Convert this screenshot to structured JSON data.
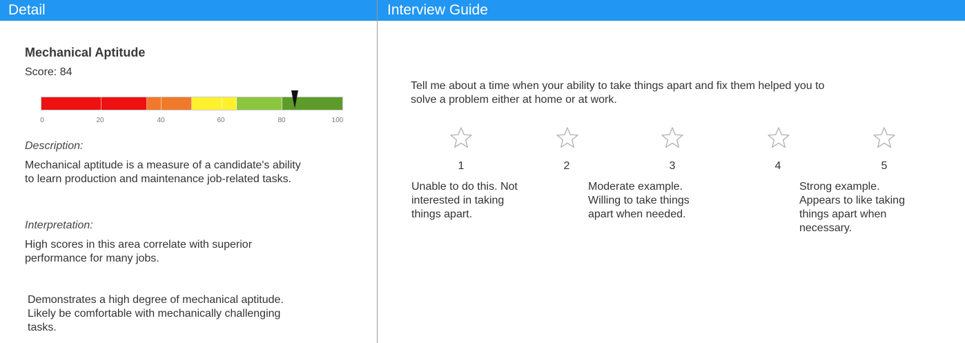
{
  "detail": {
    "header": "Detail",
    "title": "Mechanical Aptitude",
    "score_text": "Score: 84",
    "score_value": 84,
    "scale": {
      "min": 0,
      "max": 100,
      "ticks": [
        "0",
        "20",
        "40",
        "60",
        "80",
        "100"
      ],
      "bands": [
        {
          "from": 0,
          "to": 20,
          "color": "#ee1111"
        },
        {
          "from": 20,
          "to": 35,
          "color": "#ee1111"
        },
        {
          "from": 35,
          "to": 40,
          "color": "#f07a2a"
        },
        {
          "from": 40,
          "to": 50,
          "color": "#f07a2a"
        },
        {
          "from": 50,
          "to": 60,
          "color": "#fff12e"
        },
        {
          "from": 60,
          "to": 65,
          "color": "#fff12e"
        },
        {
          "from": 65,
          "to": 80,
          "color": "#8cc540"
        },
        {
          "from": 80,
          "to": 100,
          "color": "#5e9b2a"
        }
      ]
    },
    "description_label": "Description:",
    "description": "Mechanical aptitude is a measure of a candidate's ability to learn production and maintenance job-related tasks.",
    "interpretation_label": "Interpretation:",
    "interpretation": "High scores in this area correlate with superior performance for many jobs.",
    "summary": "Demonstrates a high degree of mechanical aptitude. Likely be comfortable with mechanically challenging tasks."
  },
  "guide": {
    "header": "Interview Guide",
    "question": "Tell me about a time when your ability to take things apart and fix them helped you to solve a problem either at home or at work.",
    "ratings": [
      "1",
      "2",
      "3",
      "4",
      "5"
    ],
    "anchors": {
      "low": "Unable to do this. Not interested in taking things apart.",
      "mid": "Moderate example. Willing to take things apart when needed.",
      "high": "Strong example. Appears to like taking things apart when necessary."
    },
    "star_icon": "star-outline-icon"
  },
  "colors": {
    "header_bg": "#2196f3",
    "header_text": "#ffffff",
    "marker": "#111111"
  }
}
